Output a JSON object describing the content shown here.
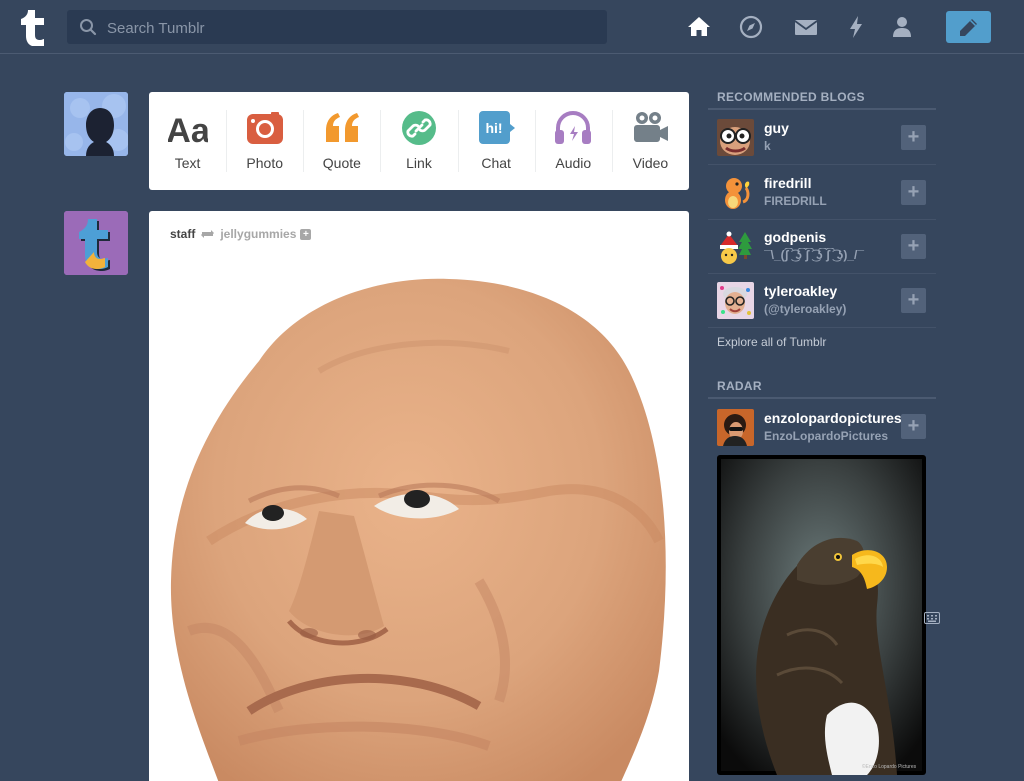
{
  "header": {
    "search_placeholder": "Search Tumblr",
    "nav": [
      "home-icon",
      "explore-compass-icon",
      "inbox-mail-icon",
      "activity-lightning-icon",
      "account-person-icon"
    ],
    "compose_icon": "pencil-icon",
    "colors": {
      "background": "#36465d",
      "search_bg": "#2a3a52",
      "compose": "#529ecc"
    }
  },
  "post_types": [
    {
      "label": "Text",
      "icon": "text-aa-icon",
      "color": "#444444"
    },
    {
      "label": "Photo",
      "icon": "camera-icon",
      "color": "#d95e40"
    },
    {
      "label": "Quote",
      "icon": "quote-icon",
      "color": "#f2992e"
    },
    {
      "label": "Link",
      "icon": "link-icon",
      "color": "#56bc8a"
    },
    {
      "label": "Chat",
      "icon": "chat-bubble-icon",
      "color": "#529ecc",
      "icon_text": "hi!"
    },
    {
      "label": "Audio",
      "icon": "headphones-icon",
      "color": "#a77dc2"
    },
    {
      "label": "Video",
      "icon": "video-camera-icon",
      "color": "#748089"
    }
  ],
  "post": {
    "author": "staff",
    "source": "jellygummies",
    "follow_symbol": "+"
  },
  "sidebar": {
    "recommended_title": "RECOMMENDED BLOGS",
    "recommended": [
      {
        "name": "guy",
        "sub": "k"
      },
      {
        "name": "firedrill",
        "sub": "FIREDRILL"
      },
      {
        "name": "godpenis",
        "sub": "¯\\_(ʃ͡ ͜͡ ʖ͡ ʃ͡ ͜͡ ʖ͡ ʃ͡ ͜͡ ʖ)_/¯"
      },
      {
        "name": "tyleroakley",
        "sub": "(@tyleroakley)"
      }
    ],
    "explore_label": "Explore all of Tumblr",
    "radar_title": "RADAR",
    "radar": {
      "name": "enzolopardopictures",
      "sub": "EnzoLopardoPictures",
      "watermark": "©Enzo Lopardo Pictures"
    },
    "plus_symbol": "+"
  }
}
